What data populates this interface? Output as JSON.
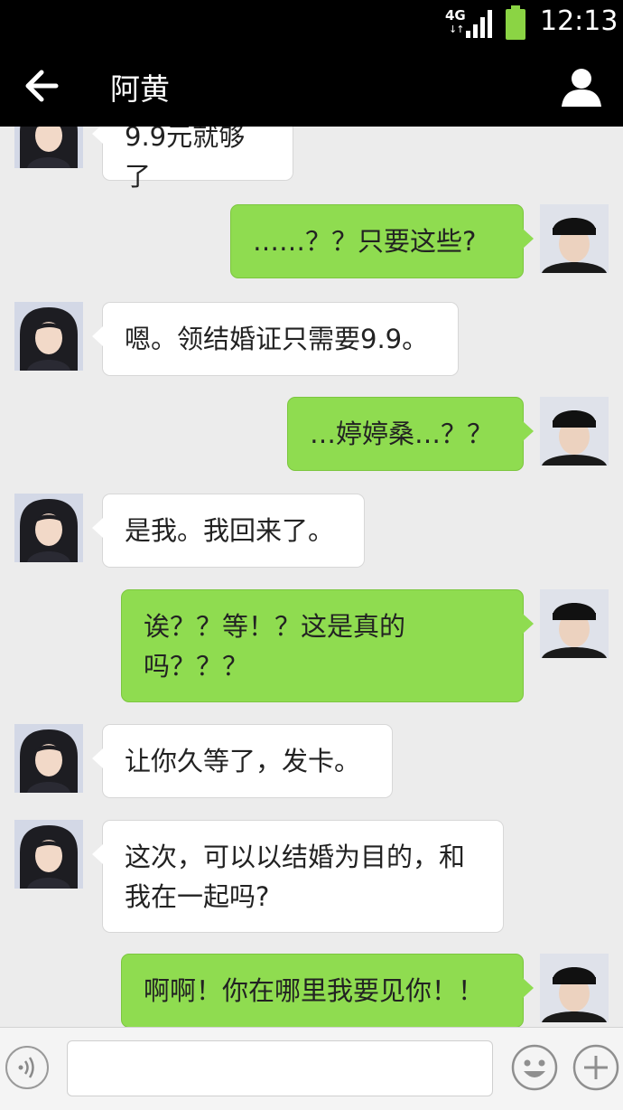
{
  "status": {
    "network": "4G",
    "arrows": "↓↑",
    "time": "12:13"
  },
  "header": {
    "title": "阿黄"
  },
  "messages": [
    {
      "side": "in",
      "text": "9.9元就够了"
    },
    {
      "side": "out",
      "text": "……？？只要这些?"
    },
    {
      "side": "in",
      "text": "嗯。领结婚证只需要9.9。"
    },
    {
      "side": "out",
      "text": "…婷婷桑…？？"
    },
    {
      "side": "in",
      "text": "是我。我回来了。"
    },
    {
      "side": "out",
      "text": "诶？？等！？这是真的吗？？？"
    },
    {
      "side": "in",
      "text": "让你久等了，发卡。"
    },
    {
      "side": "in",
      "text": "这次，可以以结婚为目的，和我在一起吗?"
    },
    {
      "side": "out",
      "text": "啊啊！你在哪里我要见你！！"
    }
  ],
  "input": {
    "value": ""
  },
  "colors": {
    "bar": "#000000",
    "outgoing": "#8fdc50",
    "incoming": "#ffffff",
    "background": "#ececec"
  }
}
